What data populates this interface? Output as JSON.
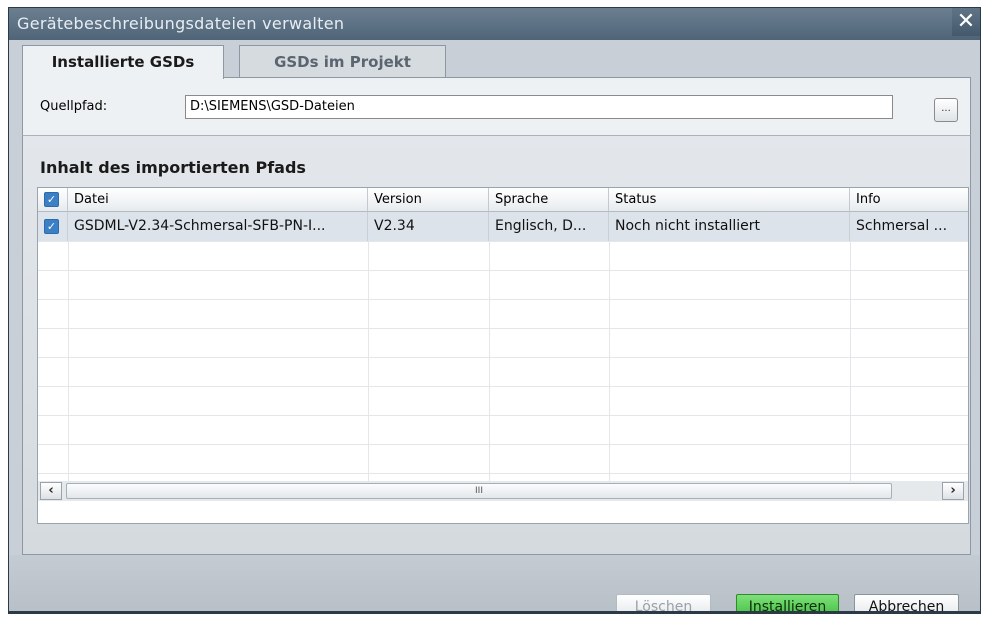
{
  "dialog": {
    "title": "Gerätebeschreibungsdateien verwalten",
    "close_label": "✕"
  },
  "tabs": [
    {
      "label": "Installierte GSDs",
      "active": true
    },
    {
      "label": "GSDs im Projekt",
      "active": false
    }
  ],
  "source": {
    "label": "Quellpfad:",
    "value": "D:\\SIEMENS\\GSD-Dateien",
    "browse_label": "..."
  },
  "content": {
    "heading": "Inhalt des importierten Pfads"
  },
  "table": {
    "columns": [
      "Datei",
      "Version",
      "Sprache",
      "Status",
      "Info"
    ],
    "header_checked": true,
    "rows": [
      {
        "checked": true,
        "datei": "GSDML-V2.34-Schmersal-SFB-PN-I...",
        "version": "V2.34",
        "sprache": "Englisch, D...",
        "status": "Noch nicht installiert",
        "info": "Schmersal ..."
      }
    ],
    "scrollbar": {
      "left_arrow": "‹",
      "right_arrow": "›",
      "thumb_grip": "III"
    }
  },
  "buttons": {
    "delete": "Löschen",
    "install": "Installieren",
    "cancel": "Abbrechen"
  },
  "colors": {
    "titlebar": "#4f6577",
    "install_button": "#3ebd3a",
    "checkbox": "#3b7fc6",
    "selected_row": "#dde3ea"
  }
}
